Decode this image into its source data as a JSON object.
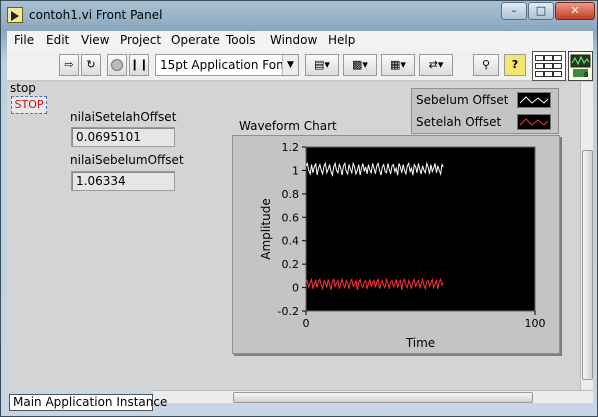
{
  "window": {
    "title": "contoh1.vi Front Panel"
  },
  "menu": [
    "File",
    "Edit",
    "View",
    "Project",
    "Operate",
    "Tools",
    "Window",
    "Help"
  ],
  "toolbar": {
    "font_label": "15pt Application Font"
  },
  "controls": {
    "stop_label": "stop",
    "stop_button_text": "STOP",
    "offset_after": {
      "label": "nilaiSetelahOffset",
      "value": "0.0695101"
    },
    "offset_before": {
      "label": "nilaiSebelumOffset",
      "value": "1.06334"
    }
  },
  "chart_data": {
    "type": "line",
    "title": "Waveform Chart",
    "xlabel": "Time",
    "ylabel": "Amplitude",
    "xlim": [
      0,
      100
    ],
    "ylim": [
      -0.2,
      1.2
    ],
    "x_ticks": [
      "0",
      "100"
    ],
    "y_ticks": [
      "1.2",
      "1",
      "0.8",
      "0.6",
      "0.4",
      "0.2",
      "0",
      "-0.2"
    ],
    "legend_position": "top-right",
    "series": [
      {
        "name": "Sebelum Offset",
        "color": "#ffffff",
        "values": [
          1.04,
          1.06,
          1.0,
          0.97,
          1.05,
          0.98,
          1.03,
          1.06,
          0.96,
          1.02,
          1.05,
          1.0,
          0.97,
          1.04,
          1.06,
          0.98,
          1.01,
          1.05,
          0.99,
          0.96,
          1.03,
          1.06,
          1.0,
          0.98,
          1.05,
          1.02,
          0.96,
          1.04,
          1.06,
          0.99,
          0.97,
          1.05,
          1.01,
          0.98,
          1.06,
          1.03,
          0.97,
          1.0,
          1.05,
          0.96,
          1.02,
          1.06,
          0.99,
          1.03,
          0.97,
          1.05,
          1.0,
          0.98,
          1.06,
          1.02,
          0.97,
          1.04,
          1.06,
          1.0,
          0.96,
          1.03,
          1.05,
          0.99,
          0.98,
          1.06,
          1.01,
          0.97,
          1.04,
          1.05,
          0.99,
          1.02,
          0.96,
          1.06,
          1.03,
          0.98,
          1.05,
          1.0,
          0.97,
          1.04,
          1.06,
          0.99,
          1.02,
          0.96,
          1.05,
          1.03,
          0.98,
          1.06,
          1.01,
          0.97,
          1.04,
          1.0,
          0.98,
          1.06,
          1.03,
          0.97,
          1.05,
          0.99,
          1.02,
          1.06,
          0.98,
          1.04,
          1.0,
          0.97,
          1.05,
          1.03
        ]
      },
      {
        "name": "Setelah Offset",
        "color": "#ff3333",
        "values": [
          0.07,
          0.05,
          0.0,
          0.04,
          0.07,
          -0.01,
          0.03,
          0.06,
          0.0,
          0.05,
          0.07,
          0.02,
          -0.01,
          0.06,
          0.04,
          0.0,
          0.07,
          0.03,
          -0.02,
          0.05,
          0.07,
          0.01,
          0.04,
          0.06,
          -0.01,
          0.03,
          0.07,
          0.02,
          0.0,
          0.06,
          0.04,
          -0.01,
          0.05,
          0.07,
          0.01,
          0.03,
          0.06,
          -0.02,
          0.04,
          0.07,
          0.02,
          0.0,
          0.05,
          0.06,
          -0.01,
          0.03,
          0.07,
          0.01,
          0.04,
          0.06,
          0.0,
          0.05,
          0.07,
          -0.01,
          0.03,
          0.06,
          0.02,
          0.0,
          0.07,
          0.04,
          -0.01,
          0.05,
          0.06,
          0.01,
          0.03,
          0.07,
          0.0,
          0.04,
          0.06,
          -0.02,
          0.05,
          0.07,
          0.02,
          0.0,
          0.06,
          0.03,
          -0.01,
          0.05,
          0.07,
          0.01,
          0.04,
          0.06,
          0.0,
          0.03,
          0.07,
          0.02,
          -0.01,
          0.05,
          0.06,
          0.01,
          0.04,
          0.07,
          0.0,
          0.03,
          0.06,
          -0.01,
          0.05,
          0.07,
          0.02,
          0.04
        ]
      }
    ]
  },
  "status": {
    "instance": "Main Application Instance"
  }
}
